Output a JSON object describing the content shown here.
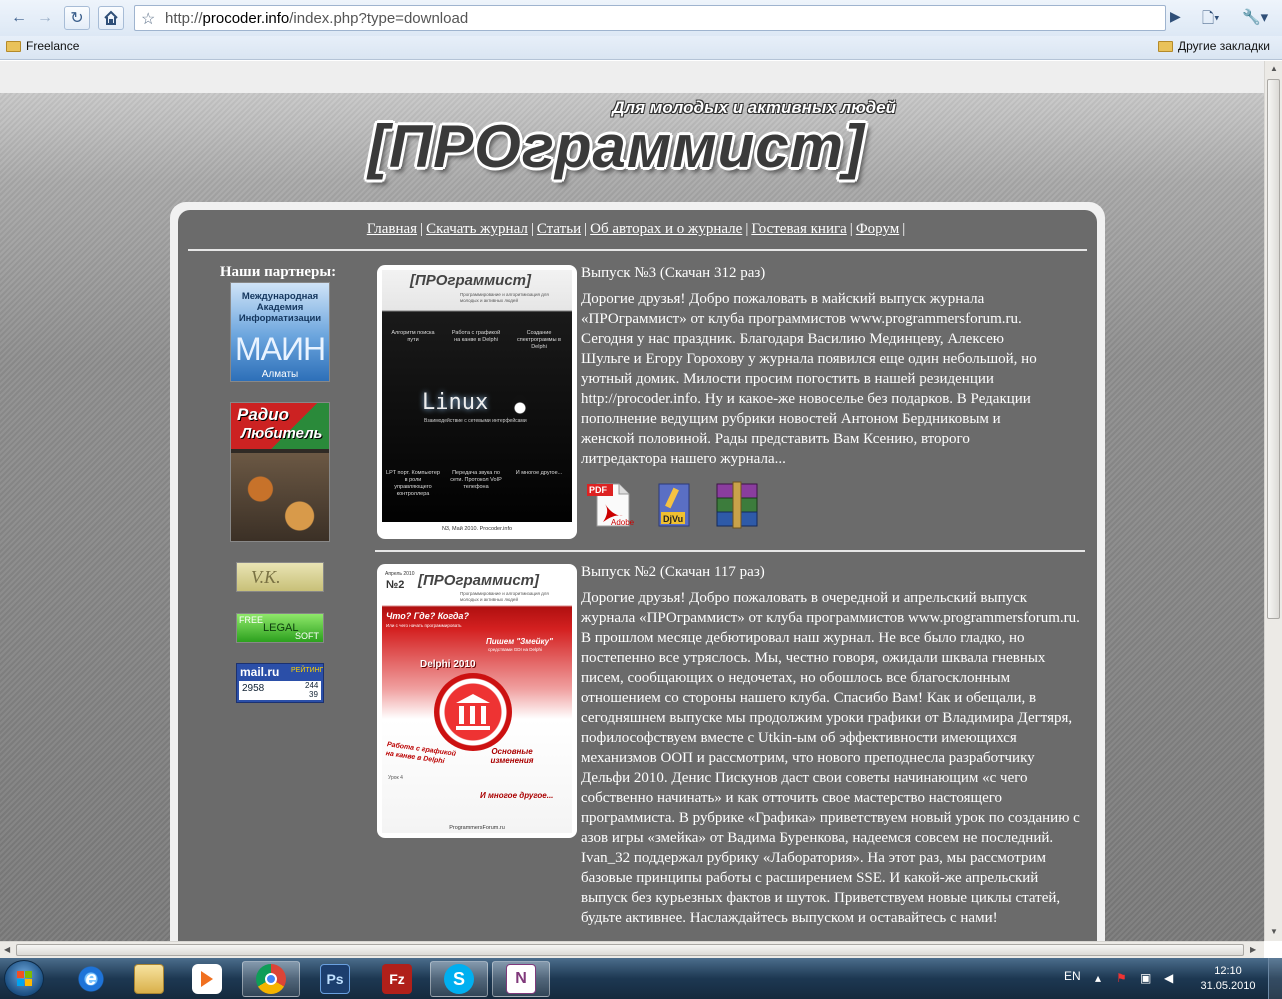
{
  "browser": {
    "url_prefix": "http://",
    "url_host": "procoder.info",
    "url_path": "/index.php?type=download",
    "bookmarks": {
      "left": "Freelance",
      "right": "Другие закладки"
    }
  },
  "site": {
    "tagline": "Для молодых и активных людей",
    "logo": "[ПРОграммист]",
    "menu": [
      "Главная",
      "Скачать журнал",
      "Статьи",
      "Об авторах и о журнале",
      "Гостевая книга",
      "Форум"
    ],
    "menu_separator": "|",
    "partners_title": "Наши партнеры:",
    "partners": [
      {
        "line1": "Международная",
        "line2": "Академия",
        "line3": "Информатизации",
        "big": "МАИН",
        "city": "Алматы"
      },
      {
        "brand_top": "Радио",
        "brand_bottom": "Любитель"
      },
      {
        "text": "V.K."
      },
      {
        "line1": "FREE",
        "line2": "LEGAL",
        "line3": "SOFT"
      },
      {
        "brand": "mail.ru",
        "label": "РЕЙТИНГ",
        "value": "2958",
        "small1": "244",
        "small2": "39"
      }
    ]
  },
  "issues": [
    {
      "title": "Выпуск №3 (Скачан 312 раз)",
      "text": "Дорогие друзья! Добро пожаловать в майский выпуск журнала «ПРОграммист» от клуба программистов www.programmersforum.ru. Сегодня у нас праздник. Благодаря Василию Мединцеву, Алексею Шульге и Егору Горохову у журнала появился еще один небольшой, но уютный домик. Милости просим погостить в нашей резиденции http://procoder.info. Ну и какое-же новоселье без подарков. В Редакции пополнение ведущим рубрики новостей Антоном Бердниковым и женской половиной. Рады представить Вам Ксению, второго литредактора нашего журнала...",
      "cover": {
        "logo": "[ПРОграммист]",
        "sub": "Программирование и алгоритмизация для молодых и активных людей",
        "topics_top": [
          "Алгоритм поиска пути",
          "Работа с графикой на канве в Delphi",
          "Создание спектрограммы в Delphi"
        ],
        "center": "Linux",
        "center_sub": "Взаимодействие с сетевыми интерфейсами",
        "topics_bottom": [
          "LPT порт. Компьютер в роли управляющего контроллера",
          "Передача звука по сети. Протокол VoIP телефона",
          "И многое другое..."
        ],
        "footer": "N3, Май 2010. Procoder.info"
      },
      "downloads": [
        {
          "icon": "pdf-icon",
          "label": "PDF",
          "sub": "Adobe"
        },
        {
          "icon": "djvu-icon",
          "label": "DjVu"
        },
        {
          "icon": "winrar-icon",
          "label": ""
        }
      ]
    },
    {
      "title": "Выпуск №2 (Скачан 117 раз)",
      "text": "Дорогие друзья! Добро пожаловать в очередной и апрельский выпуск журнала «ПРОграммист» от клуба программистов www.programmersforum.ru. В прошлом месяце дебютировал наш журнал. Не все было гладко, но постепенно все утряслось. Мы, честно говоря, ожидали шквала гневных писем, сообщающих о недочетах, но обошлось все благосклонным отношением со стороны нашего клуба. Спасибо Вам! Как и обещали, в сегодняшнем выпуске мы продолжим уроки графики от Владимира Дегтяря, пофилософствуем вместе с Utkin-ым об эффективности имеющихся механизмов ООП и рассмотрим, что нового преподнесла разработчику Дельфи 2010. Денис Пискунов даст свои советы начинающим «с чего собственно начинать» и как отточить свое мастерство настоящего программиста. В рубрике «Графика» приветствуем новый урок по созданию с азов игры «змейка» от Вадима Буренкова, надеемся совсем не последний. Ivan_32 поддержал рубрику «Лаборатория». На этот раз, мы рассмотрим базовые принципы работы с расширением SSE. И какой-же апрельский выпуск без курьезных фактов и шуток. Приветствуем новые циклы статей, будьте активнее. Наслаждайтесь выпуском и оставайтесь с нами!",
      "cover": {
        "issue_no": "№2",
        "issue_month": "Апрель 2010",
        "logo": "[ПРОграммист]",
        "sub": "Программирование и алгоритмизация для молодых и активных людей",
        "q": "Что? Где? Когда?",
        "q_sub": "Или с чего начать программировать",
        "snake": "Пишем \"Змейку\"",
        "snake_sub": "средствами GDI на Delphi",
        "delphi": "Delphi 2010",
        "changes": "Основные изменения",
        "graphics": "Работа с графикой на канве в Delphi",
        "graphics_sub": "Урок 4",
        "more": "И многое другое...",
        "footer": "ProgrammersForum.ru"
      }
    }
  ],
  "taskbar": {
    "apps": [
      "ie-icon",
      "explorer-icon",
      "media-player-icon",
      "chrome-icon",
      "photoshop-icon",
      "filezilla-icon",
      "skype-icon",
      "onenote-icon"
    ],
    "ps_label": "Ps",
    "fz_label": "Fz",
    "skype_label": "S",
    "onenote_label": "N",
    "lang": "EN",
    "time": "12:10",
    "date": "31.05.2010"
  }
}
